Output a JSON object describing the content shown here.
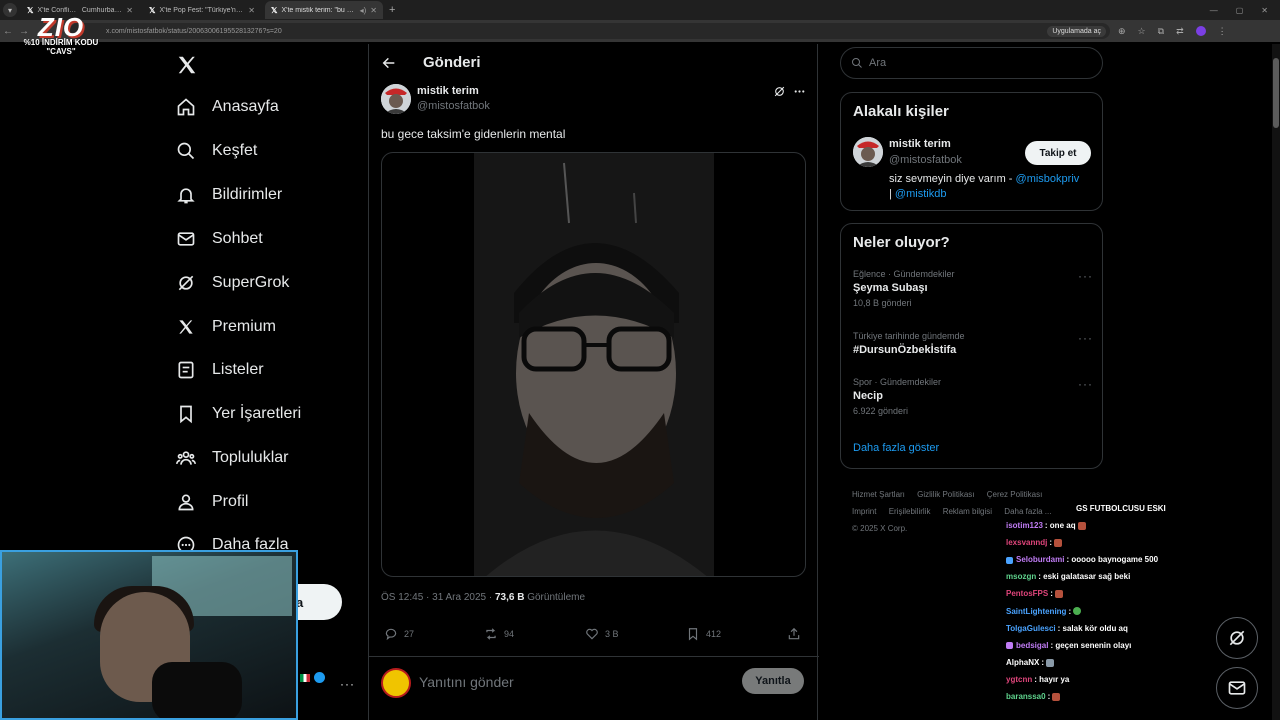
{
  "browser": {
    "tabs": [
      {
        "title": "X'te Conflict: \"",
        "extra": "Cumhurbaşkı",
        "active": false
      },
      {
        "title": "X'te Pop Fest: \"Türkiye'nin yeni",
        "active": false
      },
      {
        "title": "X'te mistik terim: \"bu gece t",
        "active": true
      }
    ],
    "url": "x.com/mistosfatbok/status/2006300619552813276?s=20",
    "translate_chip": "Uygulamada aç"
  },
  "overlay": {
    "logo_text": "ZIO",
    "promo_line1": "%10 İNDİRİM KODU",
    "promo_line2": "\"CAVS\""
  },
  "nav": {
    "items": [
      {
        "label": "Anasayfa",
        "icon": "home-icon"
      },
      {
        "label": "Keşfet",
        "icon": "search-icon"
      },
      {
        "label": "Bildirimler",
        "icon": "bell-icon"
      },
      {
        "label": "Sohbet",
        "icon": "mail-icon"
      },
      {
        "label": "SuperGrok",
        "icon": "grok-icon"
      },
      {
        "label": "Premium",
        "icon": "x-logo-icon"
      },
      {
        "label": "Listeler",
        "icon": "list-icon"
      },
      {
        "label": "Yer İşaretleri",
        "icon": "bookmark-icon"
      },
      {
        "label": "Topluluklar",
        "icon": "communities-icon"
      },
      {
        "label": "Profil",
        "icon": "profile-icon"
      },
      {
        "label": "Daha fazla",
        "icon": "more-circle-icon"
      }
    ],
    "post_button_fragment": "a"
  },
  "main": {
    "title": "Gönderi",
    "post": {
      "author_name": "mistik terim",
      "author_handle": "@mistosfatbok",
      "text": "bu gece taksim'e gidenlerin mental",
      "time": "ÖS 12:45 · 31 Ara 2025 · ",
      "views_count": "73,6 B",
      "views_label": " Görüntüleme",
      "replies": "27",
      "reposts": "94",
      "likes": "3 B",
      "bookmarks": "412"
    },
    "reply_placeholder": "Yanıtını gönder",
    "reply_button": "Yanıtla"
  },
  "right": {
    "search_placeholder": "Ara",
    "related": {
      "title": "Alakalı kişiler",
      "name": "mistik terim",
      "handle": "@mistosfatbok",
      "follow_label": "Takip et",
      "bio_text": "siz sevmeyin diye varım - ",
      "bio_link1": "@misbokpriv",
      "bio_sep": "| ",
      "bio_link2": "@mistikdb"
    },
    "trends": {
      "title": "Neler oluyor?",
      "items": [
        {
          "context": "Eğlence · Gündemdekiler",
          "name": "Şeyma Subaşı",
          "count": "10,8 B gönderi"
        },
        {
          "context": "Türkiye tarihinde gündemde",
          "name": "#DursunÖzbekİstifa",
          "count": ""
        },
        {
          "context": "Spor · Gündemdekiler",
          "name": "Necip",
          "count": "6.922 gönderi"
        }
      ],
      "show_more": "Daha fazla göster"
    },
    "footer": {
      "links": [
        "Hizmet Şartları",
        "Gizlilik Politikası",
        "Çerez Politikası",
        "Imprint",
        "Erişilebilirlik",
        "Reklam bilgisi",
        "Daha fazla ..."
      ],
      "copyright": "© 2025 X Corp."
    }
  },
  "chat": [
    {
      "user": "",
      "msg": "GS FUTBOLCUSU ESKI",
      "color": "#ffffff"
    },
    {
      "user": "isotim123",
      "msg": ": one aq",
      "color": "#c07cf5",
      "emote": true
    },
    {
      "user": "lexsvanndj",
      "msg": ":",
      "color": "#e0457b",
      "emote": true
    },
    {
      "user": "Seloburdami",
      "msg": ": ooooo baynogame 500",
      "color": "#c07cf5",
      "badge": true
    },
    {
      "user": "msozgn",
      "msg": ": eski galatasar sağ beki",
      "color": "#5fd38d"
    },
    {
      "user": "PentosFPS",
      "msg": ":",
      "color": "#e0457b",
      "emote": true
    },
    {
      "user": "SaintLightening",
      "msg": ":",
      "color": "#4aa3ff",
      "emote_green": true
    },
    {
      "user": "TolgaGulesci",
      "msg": ": salak kör oldu aq",
      "color": "#4aa3ff"
    },
    {
      "user": "bedsigal",
      "msg": ": geçen senenin olayı",
      "color": "#c07cf5",
      "badge": true
    },
    {
      "user": "AlphaNX",
      "msg": ":",
      "color": "#ffffff",
      "emote_grey": true
    },
    {
      "user": "ygtcnn",
      "msg": ": hayır ya",
      "color": "#e0457b"
    },
    {
      "user": "baranssa0",
      "msg": ":",
      "color": "#5fd38d",
      "emote": true
    }
  ],
  "colors": {
    "accent": "#1d9bf0",
    "background": "#000000",
    "border": "#2f3336",
    "muted": "#71767b"
  }
}
